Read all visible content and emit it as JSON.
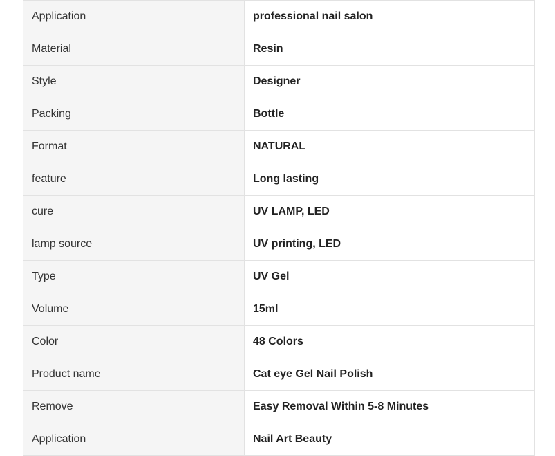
{
  "spec_table": {
    "rows": [
      {
        "key": "Application",
        "value": "professional nail salon"
      },
      {
        "key": "Material",
        "value": "Resin"
      },
      {
        "key": "Style",
        "value": "Designer"
      },
      {
        "key": "Packing",
        "value": "Bottle"
      },
      {
        "key": "Format",
        "value": "NATURAL"
      },
      {
        "key": "feature",
        "value": "Long lasting"
      },
      {
        "key": "cure",
        "value": "UV LAMP, LED"
      },
      {
        "key": "lamp source",
        "value": "UV printing, LED"
      },
      {
        "key": "Type",
        "value": "UV Gel"
      },
      {
        "key": "Volume",
        "value": "15ml"
      },
      {
        "key": "Color",
        "value": "48 Colors"
      },
      {
        "key": "Product name",
        "value": "Cat eye Gel Nail Polish"
      },
      {
        "key": "Remove",
        "value": "Easy Removal Within 5-8 Minutes"
      },
      {
        "key": "Application",
        "value": "Nail Art Beauty"
      }
    ]
  }
}
